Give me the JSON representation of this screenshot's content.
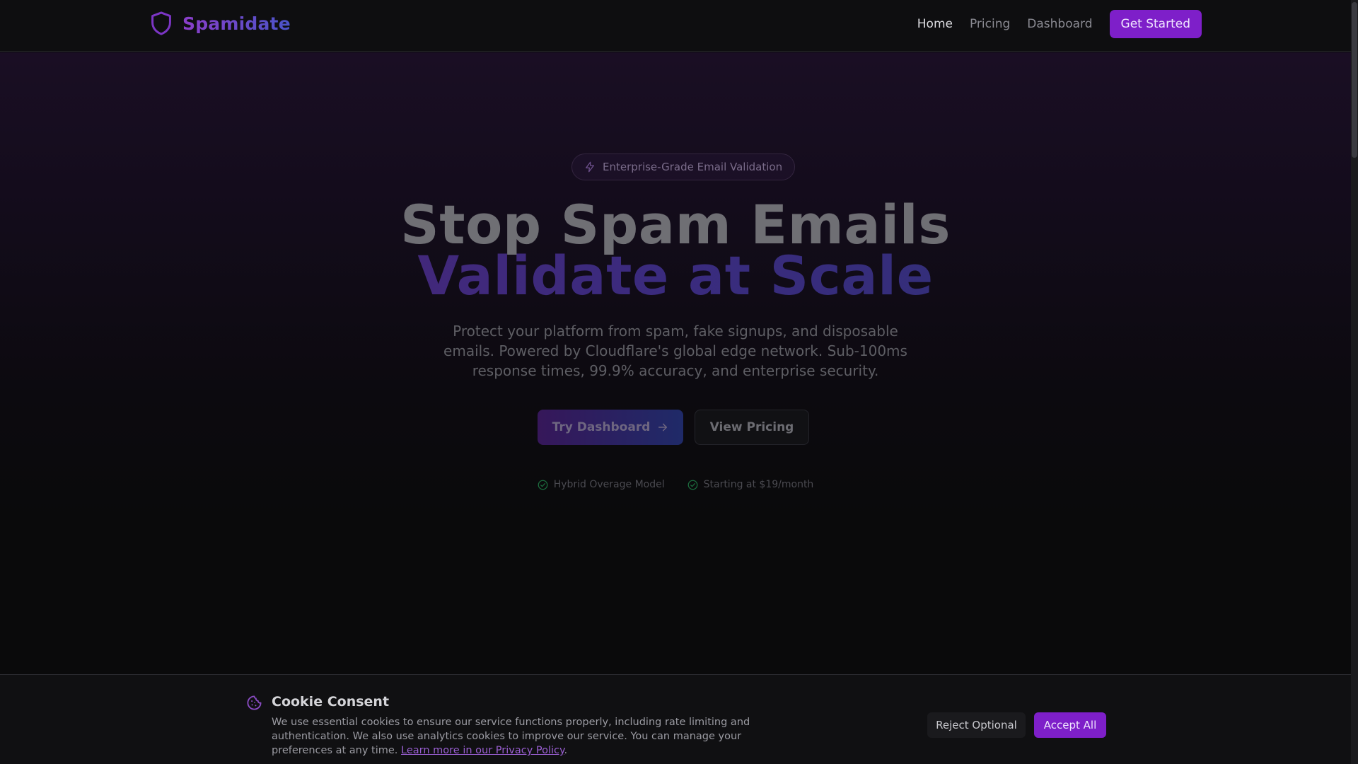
{
  "nav": {
    "brand_name": "Spamidate",
    "brand_icon": "shield-icon",
    "links": [
      {
        "label": "Home",
        "active": true
      },
      {
        "label": "Pricing",
        "active": false
      },
      {
        "label": "Dashboard",
        "active": false
      }
    ],
    "cta_label": "Get Started"
  },
  "hero": {
    "badge_icon": "lightning-icon",
    "badge_text": "Enterprise-Grade Email Validation",
    "title_line1": "Stop Spam Emails",
    "title_line2": "Validate at Scale",
    "subtitle": "Protect your platform from spam, fake signups, and disposable emails. Powered by Cloudflare's global edge network. Sub-100ms response times, 99.9% accuracy, and enterprise security.",
    "primary_cta": "Try Dashboard",
    "primary_cta_icon": "arrow-right-icon",
    "secondary_cta": "View Pricing",
    "features": [
      {
        "icon": "check-circle-icon",
        "label": "Hybrid Overage Model"
      },
      {
        "icon": "check-circle-icon",
        "label": "Starting at $19/month"
      }
    ]
  },
  "cookie": {
    "icon": "cookie-icon",
    "title": "Cookie Consent",
    "text": "We use essential cookies to ensure our service functions properly, including rate limiting and authentication. We also use analytics cookies to improve our service. You can manage your preferences at any time. ",
    "link_text": "Learn more in our Privacy Policy",
    "text_end": ".",
    "reject_label": "Reject Optional",
    "accept_label": "Accept All"
  },
  "colors": {
    "accent": "#7e1fc9",
    "brand_gradient_start": "#8b3ec9",
    "brand_gradient_end": "#4a54c8",
    "background": "#0a0a0b",
    "success": "#1f8a4c"
  }
}
